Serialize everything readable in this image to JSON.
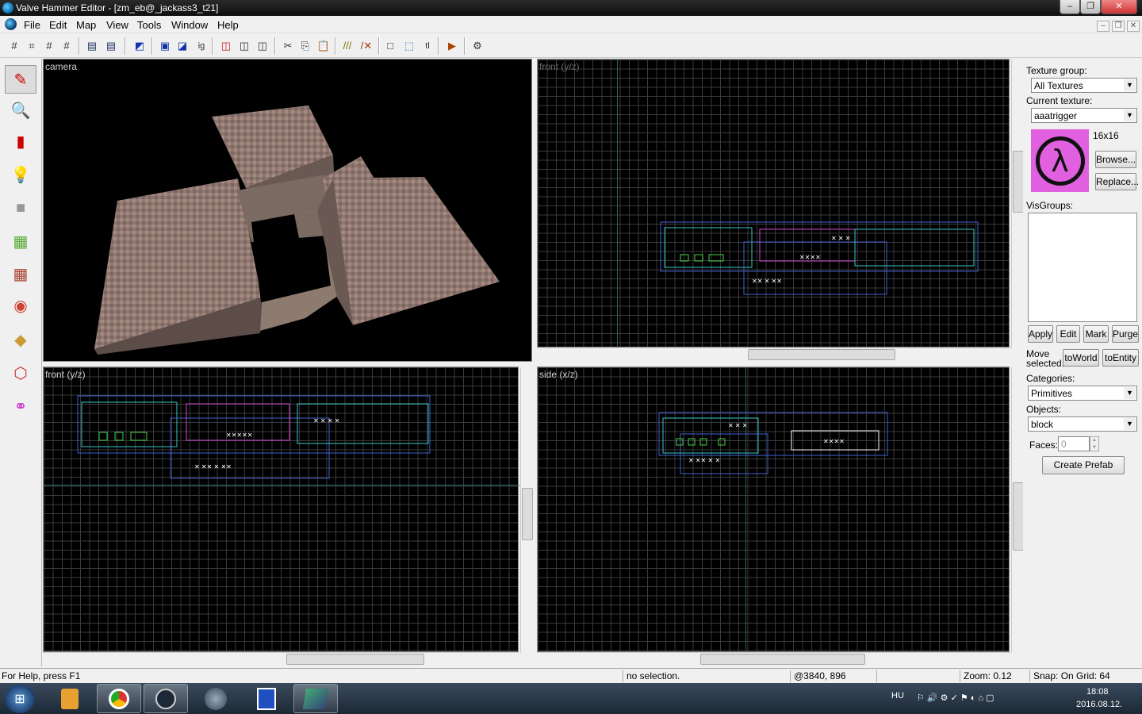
{
  "window": {
    "title": "Valve Hammer Editor - [zm_eb@_jackass3_t21]"
  },
  "menu": [
    "File",
    "Edit",
    "Map",
    "View",
    "Tools",
    "Window",
    "Help"
  ],
  "views": {
    "camera": "camera",
    "top_right": "front (y/z)",
    "bottom_left": "front (y/z)",
    "bottom_right": "side (x/z)"
  },
  "panel": {
    "texture_group_label": "Texture group:",
    "texture_group_value": "All Textures",
    "current_texture_label": "Current texture:",
    "current_texture_value": "aaatrigger",
    "texture_size": "16x16",
    "browse_label": "Browse...",
    "replace_label": "Replace...",
    "visgroups_label": "VisGroups:",
    "apply_label": "Apply",
    "edit_label": "Edit",
    "mark_label": "Mark",
    "purge_label": "Purge",
    "move_selected_label_1": "Move",
    "move_selected_label_2": "selected:",
    "to_world_label": "toWorld",
    "to_entity_label": "toEntity",
    "categories_label": "Categories:",
    "categories_value": "Primitives",
    "objects_label": "Objects:",
    "objects_value": "block",
    "faces_label": "Faces:",
    "faces_value": "0",
    "create_prefab_label": "Create Prefab"
  },
  "status": {
    "help": "For Help, press F1",
    "selection": "no selection.",
    "coords": "@3840, 896",
    "zoom": "Zoom: 0.12",
    "snap": "Snap: On Grid: 64"
  },
  "tray": {
    "lang": "HU",
    "time": "18:08",
    "date": "2016.08.12."
  },
  "colors": {
    "grid": "#3a3a3a",
    "brush_blue": "#3f5fd0",
    "brush_cyan": "#38c8c8",
    "entity_green": "#48d048",
    "entity_magenta": "#d048d0"
  }
}
